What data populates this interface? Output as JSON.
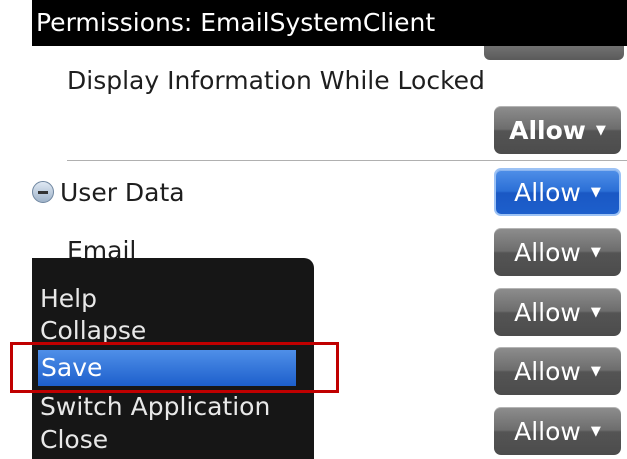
{
  "title": "Permissions: EmailSystemClient",
  "rows": [
    {
      "label": "Display Information While Locked",
      "button": "Allow"
    },
    {
      "label": "User Data",
      "button": "Allow"
    },
    {
      "label": "Email",
      "button": "Allow"
    },
    {
      "label": "",
      "button": "Allow"
    },
    {
      "label": "",
      "button": "Allow"
    },
    {
      "label": "",
      "button": "Allow"
    }
  ],
  "menu": {
    "items": [
      "Help",
      "Collapse",
      "Save",
      "Switch Application",
      "Close"
    ],
    "selected": "Save"
  },
  "colors": {
    "titlebar": "#000000",
    "selected_blue": "#2b6fd6",
    "highlight_outline": "#c00000"
  }
}
